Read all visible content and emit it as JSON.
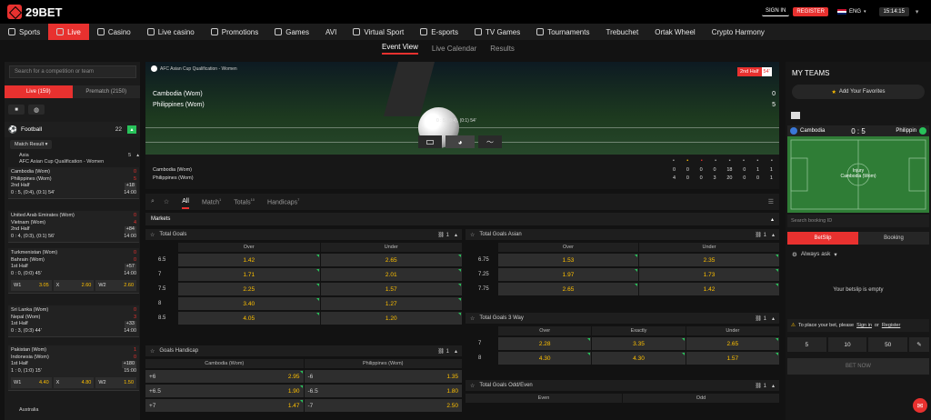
{
  "header": {
    "logo": "29BET",
    "signin": "SIGN IN",
    "register": "REGISTER",
    "lang": "ENG",
    "time": "15:14:15"
  },
  "nav": [
    {
      "label": "Sports",
      "icon": "football-icon"
    },
    {
      "label": "Live",
      "icon": "live-icon"
    },
    {
      "label": "Casino",
      "icon": "slot-icon"
    },
    {
      "label": "Live casino",
      "icon": "dealer-icon"
    },
    {
      "label": "Promotions",
      "icon": "gift-icon"
    },
    {
      "label": "Games",
      "icon": "dice-icon"
    },
    {
      "label": "AVI",
      "icon": ""
    },
    {
      "label": "Virtual Sport",
      "icon": "virtual-icon"
    },
    {
      "label": "E-sports",
      "icon": "gamepad-icon"
    },
    {
      "label": "TV Games",
      "icon": "tv-icon"
    },
    {
      "label": "Tournaments",
      "icon": "trophy-icon"
    },
    {
      "label": "Trebuchet",
      "icon": ""
    },
    {
      "label": "Ortak Wheel",
      "icon": ""
    },
    {
      "label": "Crypto Harmony",
      "icon": ""
    }
  ],
  "subnav": [
    "Event View",
    "Live Calendar",
    "Results"
  ],
  "left": {
    "search_placeholder": "Search for a competition or team",
    "tab_live": "Live (159)",
    "tab_prematch": "Prematch (2150)",
    "sport": "Football",
    "sport_count": "22",
    "filter": "Match Result",
    "region": "Asia",
    "league": "AFC Asian Cup Qualification - Women",
    "league_count": "5",
    "matches": [
      {
        "t1": "Cambodia (Wom)",
        "t2": "Philippines (Wom)",
        "s1": "0",
        "s2": "5",
        "phase": "2nd Half",
        "info": "0 : 5, (0:4), (0:1) 54'",
        "more": "+18",
        "time": "14:00",
        "odds": []
      },
      {
        "t1": "United Arab Emirates (Wom)",
        "t2": "Vietnam (Wom)",
        "s1": "0",
        "s2": "4",
        "phase": "2nd Half",
        "info": "0 : 4, (0:3), (0:1) 56'",
        "more": "+84",
        "time": "14:00",
        "odds": []
      },
      {
        "t1": "Turkmenistan (Wom)",
        "t2": "Bahrain (Wom)",
        "s1": "0",
        "s2": "0",
        "phase": "1st Half",
        "info": "0 : 0, (0:0) 45'",
        "more": "+57",
        "time": "14:00",
        "odds": [
          {
            "l": "W1",
            "v": "3.05"
          },
          {
            "l": "X",
            "v": "2.60"
          },
          {
            "l": "W2",
            "v": "2.60"
          }
        ]
      },
      {
        "t1": "Sri Lanka (Wom)",
        "t2": "Nepal (Wom)",
        "s1": "0",
        "s2": "3",
        "phase": "1st Half",
        "info": "0 : 3, (0:3) 44'",
        "more": "+33",
        "time": "14:00",
        "odds": []
      },
      {
        "t1": "Pakistan (Wom)",
        "t2": "Indonesia (Wom)",
        "s1": "1",
        "s2": "0",
        "phase": "1st Half",
        "info": "1 : 0, (1:0) 15'",
        "more": "+180",
        "time": "15:00",
        "odds": [
          {
            "l": "W1",
            "v": "4.40"
          },
          {
            "l": "X",
            "v": "4.80"
          },
          {
            "l": "W2",
            "v": "1.50"
          }
        ]
      }
    ],
    "next_region": "Australia"
  },
  "event": {
    "league": "AFC Asian Cup Qualification - Women",
    "phase": "2nd Half",
    "minute": "54'",
    "team1": "Cambodia (Wom)",
    "team2": "Philippines (Wom)",
    "score1": "0",
    "score2": "5",
    "detail": "0 : 5, (0:4), (0:1) 54'",
    "stats": [
      {
        "team": "Cambodia (Wom)",
        "vals": [
          "0",
          "0",
          "0",
          "0",
          "18",
          "0",
          "1",
          "1"
        ]
      },
      {
        "team": "Philippines (Wom)",
        "vals": [
          "4",
          "0",
          "0",
          "3",
          "20",
          "0",
          "0",
          "1"
        ]
      }
    ]
  },
  "bettabs": {
    "all": "All",
    "match": "Match",
    "match_count": "1",
    "totals": "Totals",
    "totals_count": "10",
    "handicaps": "Handicaps",
    "handicaps_count": "7"
  },
  "markets_label": "Markets",
  "total_goals": {
    "title": "Total Goals",
    "count": "1",
    "over": "Over",
    "under": "Under",
    "rows": [
      {
        "l": "6.5",
        "o": "1.42",
        "u": "2.65"
      },
      {
        "l": "7",
        "o": "1.71",
        "u": "2.01"
      },
      {
        "l": "7.5",
        "o": "2.25",
        "u": "1.57"
      },
      {
        "l": "8",
        "o": "3.40",
        "u": "1.27"
      },
      {
        "l": "8.5",
        "o": "4.05",
        "u": "1.20"
      }
    ]
  },
  "goals_handicap": {
    "title": "Goals Handicap",
    "count": "1",
    "home": "Cambodia (Wom)",
    "away": "Philippines (Wom)",
    "rows": [
      {
        "hl": "+6",
        "hv": "2.95",
        "al": "-6",
        "av": "1.35"
      },
      {
        "hl": "+6.5",
        "hv": "1.90",
        "al": "-6.5",
        "av": "1.80"
      },
      {
        "hl": "+7",
        "hv": "1.47",
        "al": "-7",
        "av": "2.50"
      }
    ]
  },
  "total_asian": {
    "title": "Total Goals Asian",
    "count": "1",
    "over": "Over",
    "under": "Under",
    "rows": [
      {
        "l": "6.75",
        "o": "1.53",
        "u": "2.35"
      },
      {
        "l": "7.25",
        "o": "1.97",
        "u": "1.73"
      },
      {
        "l": "7.75",
        "o": "2.65",
        "u": "1.42"
      }
    ]
  },
  "total_3way": {
    "title": "Total Goals 3 Way",
    "count": "1",
    "over": "Over",
    "exact": "Exactly",
    "under": "Under",
    "rows": [
      {
        "l": "7",
        "o": "2.28",
        "e": "3.35",
        "u": "2.65"
      },
      {
        "l": "8",
        "o": "4.30",
        "e": "4.30",
        "u": "1.57"
      }
    ]
  },
  "odd_even": {
    "title": "Total Goals Odd/Even",
    "count": "1",
    "even": "Even",
    "odd": "Odd"
  },
  "right": {
    "my_teams": "MY TEAMS",
    "add_fav": "Add Your Favorites",
    "mini_t1": "Cambodia",
    "mini_t2": "Philippin",
    "mini_score": "0 : 5",
    "injury": "Injury",
    "injury_team": "Cambodia (Wom)",
    "booking_placeholder": "Search booking ID",
    "tab_betslip": "BetSlip",
    "tab_booking": "Booking",
    "always_ask": "Always ask",
    "empty": "Your betslip is empty",
    "notice_pre": "To place your bet, please",
    "signin": "Sign in",
    "or": "or",
    "register": "Register",
    "stakes": [
      "5",
      "10",
      "50"
    ],
    "bet_now": "BET NOW"
  }
}
